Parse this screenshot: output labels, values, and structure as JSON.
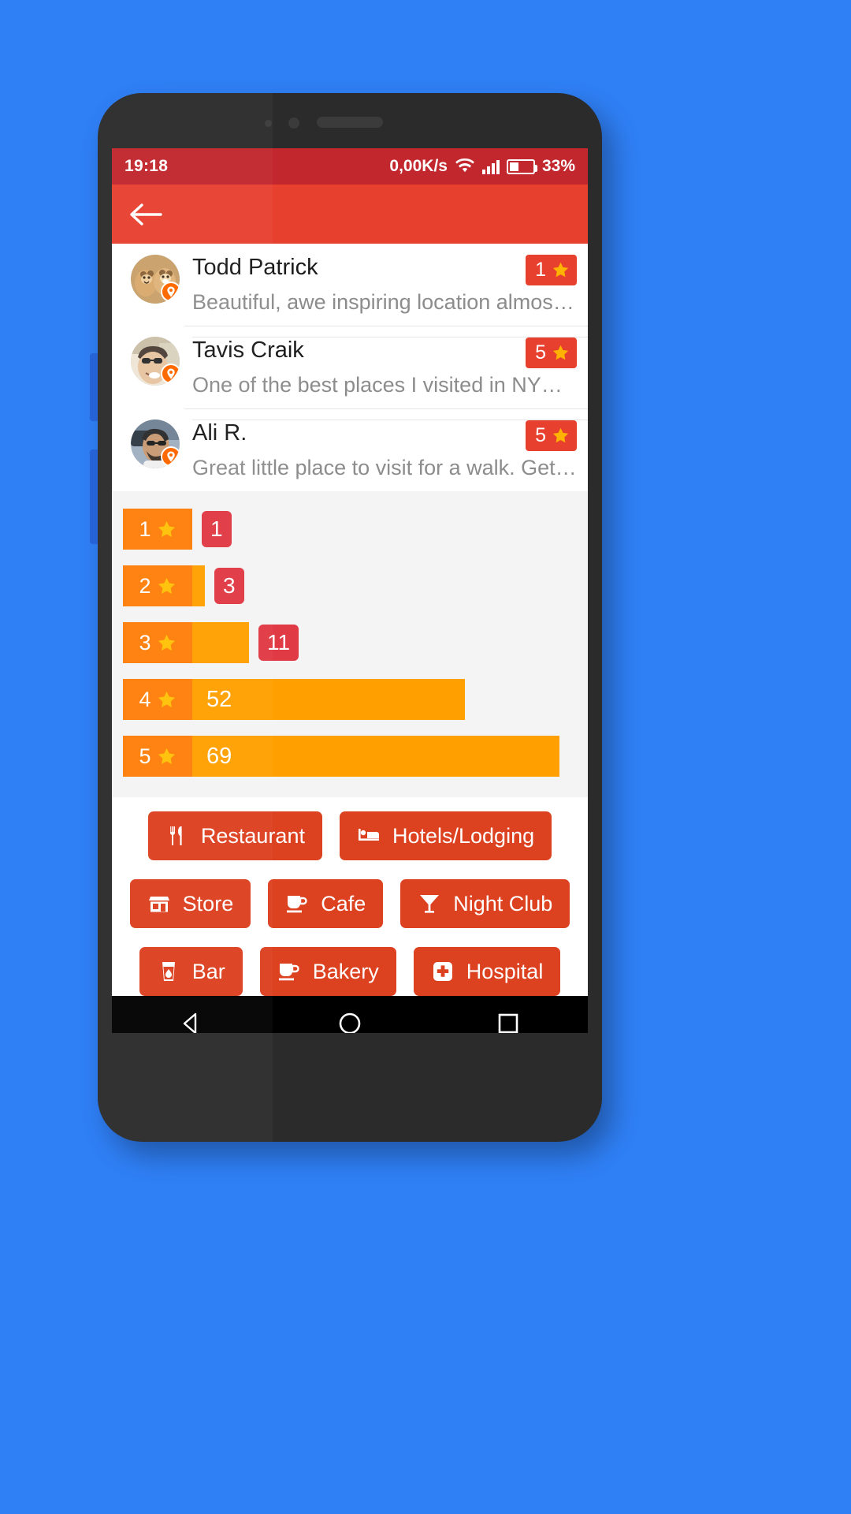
{
  "status_bar": {
    "time": "19:18",
    "network_speed": "0,00K/s",
    "battery_percent": "33%",
    "icons": [
      "wifi-icon",
      "signal-icon",
      "battery-icon"
    ]
  },
  "app_bar": {
    "back_label": "back-arrow-icon"
  },
  "reviews": [
    {
      "name": "Todd Patrick",
      "text": "Beautiful, awe inspiring location almost…",
      "rating": "1",
      "star_icon": "star-icon"
    },
    {
      "name": "Tavis Craik",
      "text": "One of the best places I visited in NYC.…",
      "rating": "5",
      "star_icon": "star-icon"
    },
    {
      "name": "Ali R.",
      "text": "Great little place to visit for a walk. Get…",
      "rating": "5",
      "star_icon": "star-icon"
    }
  ],
  "chart_data": {
    "type": "bar",
    "title": "",
    "xlabel": "",
    "ylabel": "",
    "orientation": "horizontal",
    "categories": [
      "1",
      "2",
      "3",
      "4",
      "5"
    ],
    "category_suffix": "star",
    "values": [
      1,
      3,
      11,
      52,
      69
    ],
    "value_labels": [
      "1",
      "3",
      "11",
      "52",
      "69"
    ],
    "xlim": [
      0,
      69
    ],
    "grid": false,
    "legend": null,
    "colors": {
      "bar_fill": "#ffa000",
      "label_block": "#ff7f0a",
      "count_badge": "#e03a45"
    },
    "notes": "Rating distribution: counts of reviews per star level. Bars 1-3 show count in a red badge outside the bar; bars 4-5 show count inside the orange bar."
  },
  "categories": {
    "rows": [
      [
        {
          "label": "Restaurant",
          "icon": "restaurant-icon"
        },
        {
          "label": "Hotels/Lodging",
          "icon": "hotel-bed-icon"
        }
      ],
      [
        {
          "label": "Store",
          "icon": "store-icon"
        },
        {
          "label": "Cafe",
          "icon": "cafe-cup-icon"
        },
        {
          "label": "Night Club",
          "icon": "cocktail-glass-icon"
        }
      ],
      [
        {
          "label": "Bar",
          "icon": "bar-glass-icon"
        },
        {
          "label": "Bakery",
          "icon": "bakery-cup-icon"
        },
        {
          "label": "Hospital",
          "icon": "hospital-cross-icon"
        }
      ]
    ]
  },
  "nav_bar": {
    "back": "nav-back-icon",
    "home": "nav-home-icon",
    "recents": "nav-recents-icon"
  },
  "colors": {
    "page_background": "#2f7ff5",
    "status_bar": "#c1272d",
    "app_bar": "#e8402f",
    "accent_button": "#dc4120",
    "bar_orange": "#ffa000",
    "badge_red": "#e03a45"
  }
}
